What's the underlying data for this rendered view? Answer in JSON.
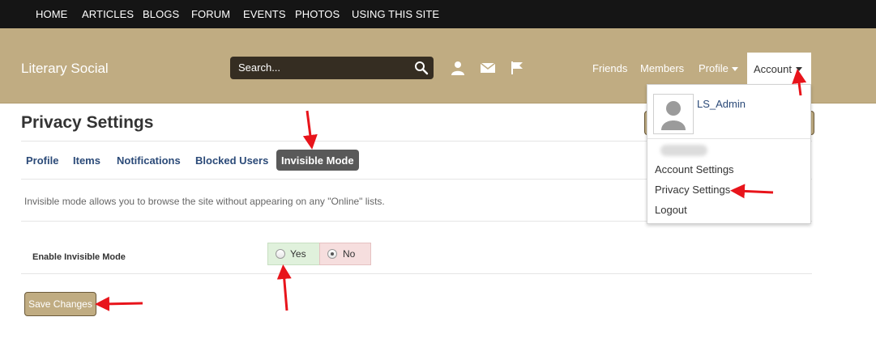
{
  "topnav": {
    "items": [
      {
        "label": "HOME"
      },
      {
        "label": "ARTICLES"
      },
      {
        "label": "BLOGS"
      },
      {
        "label": "FORUM"
      },
      {
        "label": "EVENTS"
      },
      {
        "label": "PHOTOS"
      },
      {
        "label": "USING THIS SITE"
      }
    ]
  },
  "header": {
    "brand": "Literary Social",
    "search_placeholder": "Search...",
    "icons": [
      "search-icon",
      "user-icon",
      "envelope-icon",
      "flag-icon"
    ],
    "links": {
      "friends": "Friends",
      "members": "Members",
      "profile": "Profile",
      "account": "Account"
    }
  },
  "page": {
    "title": "Privacy Settings",
    "tabs": [
      {
        "label": "Profile"
      },
      {
        "label": "Items"
      },
      {
        "label": "Notifications"
      },
      {
        "label": "Blocked Users"
      },
      {
        "label": "Invisible Mode"
      }
    ],
    "active_tab": "Invisible Mode",
    "description": "Invisible mode allows you to browse the site without appearing on any \"Online\" lists.",
    "field_label": "Enable Invisible Mode",
    "options": {
      "yes": "Yes",
      "no": "No",
      "selected": "No"
    },
    "save_label": "Save Changes"
  },
  "dropdown": {
    "username": "LS_Admin",
    "items": [
      {
        "label": "Account Settings"
      },
      {
        "label": "Privacy Settings"
      },
      {
        "label": "Logout"
      }
    ]
  },
  "colors": {
    "topnav_bg": "#151515",
    "header_bg": "#c0ac82",
    "search_bg": "#352d22",
    "link_blue": "#2b4a78",
    "active_tab_bg": "#595959",
    "yes_bg": "#e0f1dc",
    "no_bg": "#f6dede",
    "annotation_red": "#e8141b"
  }
}
